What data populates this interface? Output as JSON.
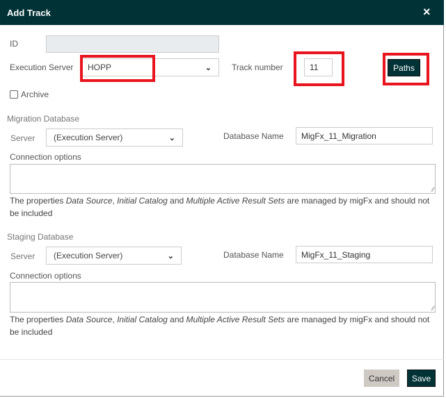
{
  "dialog": {
    "title": "Add Track",
    "close_icon": "×"
  },
  "form": {
    "id_label": "ID",
    "id_value": "",
    "execution_server_label": "Execution Server",
    "execution_server_value": "HOPP",
    "track_number_label": "Track number",
    "track_number_value": "11",
    "paths_button": "Paths",
    "archive_label": "Archive",
    "archive_checked": false
  },
  "migration": {
    "section_title": "Migration Database",
    "server_label": "Server",
    "server_value": "(Execution Server)",
    "db_name_label": "Database Name",
    "db_name_value": "MigFx_11_Migration",
    "conn_label": "Connection options",
    "conn_value": "",
    "help": {
      "p1": "The properties ",
      "i1": "Data Source",
      "p2": ", ",
      "i2": "Initial Catalog",
      "p3": " and ",
      "i3": "Multiple Active Result Sets",
      "p4": " are managed by migFx and should not be included"
    }
  },
  "staging": {
    "section_title": "Staging Database",
    "server_label": "Server",
    "server_value": "(Execution Server)",
    "db_name_label": "Database Name",
    "db_name_value": "MigFx_11_Staging",
    "conn_label": "Connection options",
    "conn_value": "",
    "help": {
      "p1": "The properties ",
      "i1": "Data Source",
      "p2": ", ",
      "i2": "Initial Catalog",
      "p3": " and ",
      "i3": "Multiple Active Result Sets",
      "p4": " are managed by migFx and should not be included"
    }
  },
  "footer": {
    "cancel": "Cancel",
    "save": "Save"
  },
  "colors": {
    "header": "#003236",
    "highlight": "#e8141e"
  }
}
